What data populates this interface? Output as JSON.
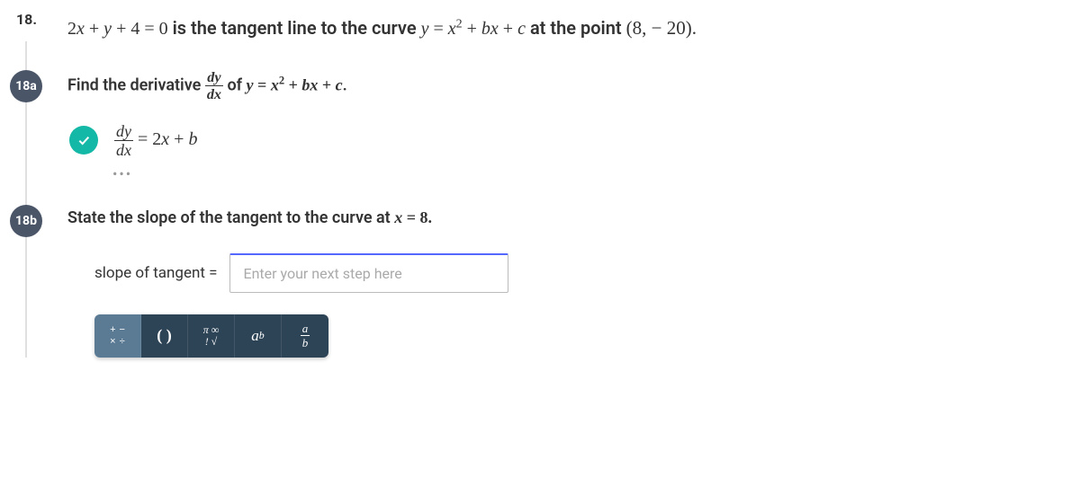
{
  "problem": {
    "number": "18.",
    "intro_pre": "2",
    "intro_mid1": " + ",
    "intro_mid2": " + 4 = 0",
    "intro_text1": " is the tangent line to the curve ",
    "intro_eq_y": "y",
    "intro_eq_eq": " = ",
    "intro_eq_x": "x",
    "intro_eq_sup": "2",
    "intro_eq_plus1": " + ",
    "intro_eq_b": "b",
    "intro_eq_x2": "x",
    "intro_eq_plus2": " + ",
    "intro_eq_c": "c",
    "intro_text2": " at the point ",
    "intro_point": "(8,  − 20).",
    "var_x": "x",
    "var_y": "y"
  },
  "part_a": {
    "badge": "18a",
    "q_pre": "Find the derivative ",
    "q_frac_num": "dy",
    "q_frac_den": "dx",
    "q_mid": " of ",
    "q_eq_y": "y",
    "q_eq": " = ",
    "q_eq_x": "x",
    "q_eq_sup": "2",
    "q_eq_plus1": " + ",
    "q_eq_b": "b",
    "q_eq_x2": "x",
    "q_eq_plus2": " + ",
    "q_eq_c": "c",
    "q_end": ".",
    "ans_frac_num": "dy",
    "ans_frac_den": "dx",
    "ans_eq": " = 2",
    "ans_x": "x",
    "ans_plus": " + ",
    "ans_b": "b",
    "dots": "•••"
  },
  "part_b": {
    "badge": "18b",
    "q_text_pre": "State the slope of the tangent to the curve at ",
    "q_x": "x",
    "q_eq": " = 8.",
    "input_label": "slope of tangent  =",
    "placeholder": "Enter your next step here"
  },
  "toolbar": {
    "btn1_a": "+",
    "btn1_b": "−",
    "btn1_c": "×",
    "btn1_d": "÷",
    "btn2": "( )",
    "btn3_a": "π ∞",
    "btn3_b": "! √",
    "btn4_base": "a",
    "btn4_sup": "b",
    "btn5_num": "a",
    "btn5_den": "b"
  }
}
